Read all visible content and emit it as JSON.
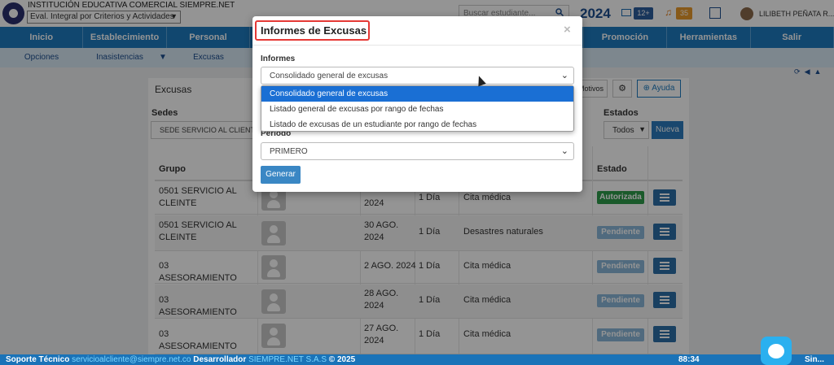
{
  "header": {
    "institution": "INSTITUCIÓN EDUCATIVA COMERCIAL SIEMPRE.NET",
    "eval_select": "Eval. Integral por Criterios y Actividades",
    "search_placeholder": "Buscar estudiante...",
    "year": "2024",
    "mail_badge": "12+",
    "bell_badge": "35",
    "user_name": "LILIBETH PEÑATA R..."
  },
  "mainnav": [
    "Inicio",
    "Establecimiento",
    "Personal",
    "",
    "",
    "",
    "",
    "Promoción",
    "Herramientas",
    "Salir"
  ],
  "subnav": {
    "opciones": "Opciones",
    "inasistencias": "Inasistencias",
    "inasistencias_arrow": "▼",
    "excusas": "Excusas"
  },
  "card": {
    "title": "Excusas",
    "motivos": "Motivos",
    "ayuda": "Ayuda",
    "sedes_label": "Sedes",
    "sede_value": "SEDE SERVICIO AL CLIENTE",
    "estados_label": "Estados",
    "estados_value": "Todos",
    "nueva": "Nueva"
  },
  "table": {
    "headers": {
      "grupo": "Grupo",
      "estado": "Estado"
    },
    "rows": [
      {
        "grupo": "0501 SERVICIO AL CLEINTE",
        "fecha": "2024",
        "dias": "1 Día",
        "motivo": "Cita médica",
        "estado": "Autorizada"
      },
      {
        "grupo": "0501 SERVICIO AL CLEINTE",
        "fecha": "30 AGO. 2024",
        "dias": "1 Día",
        "motivo": "Desastres naturales",
        "estado": "Pendiente"
      },
      {
        "grupo": "03 ASESORAMIENTO",
        "fecha": "2 AGO. 2024",
        "dias": "1 Día",
        "motivo": "Cita médica",
        "estado": "Pendiente"
      },
      {
        "grupo": "03 ASESORAMIENTO",
        "fecha": "28 AGO. 2024",
        "dias": "1 Día",
        "motivo": "Cita médica",
        "estado": "Pendiente"
      },
      {
        "grupo": "03 ASESORAMIENTO",
        "fecha": "27 AGO. 2024",
        "dias": "1 Día",
        "motivo": "Cita médica",
        "estado": "Pendiente"
      }
    ]
  },
  "modal": {
    "title": "Informes de Excusas",
    "close": "×",
    "informes_label": "Informes",
    "informes_value": "Consolidado general de excusas",
    "options": [
      "Consolidado general de excusas",
      "Listado general de excusas por rango de fechas",
      "Listado de excusas de un estudiante por rango de fechas"
    ],
    "periodo_label": "Periodo",
    "periodo_value": "PRIMERO",
    "generar": "Generar"
  },
  "footer": {
    "soporte": "Soporte Técnico",
    "email": "servicioalcliente@siempre.net.co",
    "desarrollador": "Desarrollador",
    "company": "SIEMPRE.NET S.A.S",
    "copyright": "© 2025",
    "time": "88:34",
    "brand": "Sin..."
  }
}
